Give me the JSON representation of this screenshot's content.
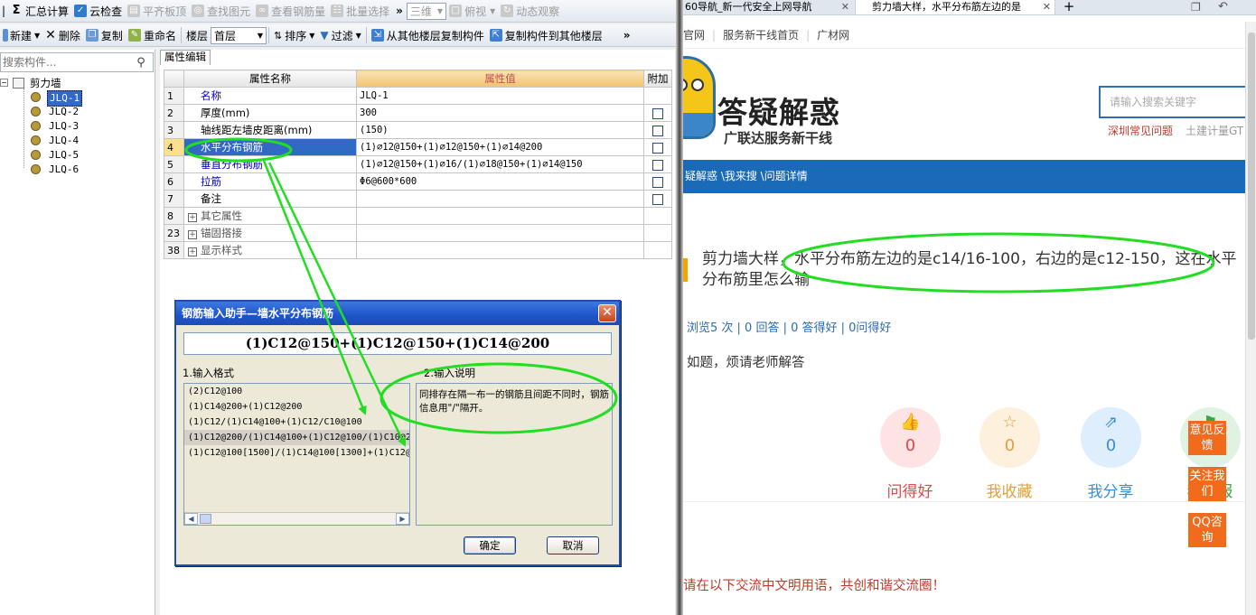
{
  "toolbar1": {
    "items": [
      {
        "icon": "sum-icon",
        "label": "汇总计算",
        "disabled": false
      },
      {
        "icon": "cloud-check-icon",
        "label": "云检查",
        "disabled": false
      },
      {
        "icon": "align-slab-icon",
        "label": "平齐板顶",
        "disabled": true
      },
      {
        "icon": "find-element-icon",
        "label": "查找图元",
        "disabled": true
      },
      {
        "icon": "view-rebar-icon",
        "label": "查看钢筋量",
        "disabled": true
      },
      {
        "icon": "batch-select-icon",
        "label": "批量选择",
        "disabled": true
      }
    ],
    "more_glyph": "»",
    "view_mode": "三维",
    "view_angle": "俯视",
    "dynamic_label": "动态观察"
  },
  "toolbar2": {
    "new_label": "新建",
    "delete_label": "删除",
    "copy_label": "复制",
    "rename_label": "重命名",
    "floor_label": "楼层",
    "floor_value": "首层",
    "sort_label": "排序",
    "filter_label": "过滤",
    "copy_from_label": "从其他楼层复制构件",
    "copy_to_label": "复制构件到其他楼层",
    "more_glyph": "»"
  },
  "left_panel": {
    "search_placeholder": "搜索构件...",
    "tree_root": "剪力墙",
    "tree_items": [
      "JLQ-1",
      "JLQ-2",
      "JLQ-3",
      "JLQ-4",
      "JLQ-5",
      "JLQ-6"
    ],
    "selected_index": 0
  },
  "property_editor": {
    "tab_label": "属性编辑",
    "headers": [
      "属性名称",
      "属性值",
      "附加"
    ],
    "rows": [
      {
        "num": "1",
        "name": "名称",
        "value": "JLQ-1",
        "blue": true,
        "checkbox": false,
        "group": false
      },
      {
        "num": "2",
        "name": "厚度(mm)",
        "value": "300",
        "blue": false,
        "checkbox": true,
        "group": false
      },
      {
        "num": "3",
        "name": "轴线距左墙皮距离(mm)",
        "value": "(150)",
        "blue": false,
        "checkbox": true,
        "group": false
      },
      {
        "num": "4",
        "name": "水平分布钢筋",
        "value": "(1)⌀12@150+(1)⌀12@150+(1)⌀14@200",
        "blue": true,
        "checkbox": true,
        "group": false,
        "selected": true
      },
      {
        "num": "5",
        "name": "垂直分布钢筋",
        "value": "(1)⌀12@150+(1)⌀16/(1)⌀18@150+(1)⌀14@150",
        "blue": true,
        "checkbox": true,
        "group": false
      },
      {
        "num": "6",
        "name": "拉筋",
        "value": "Φ6@600*600",
        "blue": true,
        "checkbox": true,
        "group": false
      },
      {
        "num": "7",
        "name": "备注",
        "value": "",
        "blue": false,
        "checkbox": true,
        "group": false
      },
      {
        "num": "8",
        "name": "其它属性",
        "value": "",
        "blue": false,
        "checkbox": false,
        "group": true
      },
      {
        "num": "23",
        "name": "锚固搭接",
        "value": "",
        "blue": false,
        "checkbox": false,
        "group": true
      },
      {
        "num": "38",
        "name": "显示样式",
        "value": "",
        "blue": false,
        "checkbox": false,
        "group": true
      }
    ]
  },
  "dialog": {
    "title": "钢筋输入助手—墙水平分布钢筋",
    "input_value": "(1)C12@150+(1)C12@150+(1)C14@200",
    "format_label": "1.输入格式",
    "desc_label": "2.输入说明",
    "formats": [
      "(2)C12@100",
      "(1)C14@200+(1)C12@200",
      "(1)C12/(1)C14@100+(1)C12/C10@100",
      "(1)C12@200/(1)C14@100+(1)C12@100/(1)C10@2",
      "(1)C12@100[1500]/(1)C14@100[1300]+(1)C12@"
    ],
    "selected_format": 3,
    "description": "同排存在隔一布一的钢筋且间距不同时，钢筋信息用\"/\"隔开。",
    "ok_label": "确定",
    "cancel_label": "取消"
  },
  "browser": {
    "tabs": [
      {
        "label": "60导航_新一代安全上网导航",
        "active": false
      },
      {
        "label": "剪力墙大样，水平分布筋左边的是",
        "active": true
      }
    ],
    "new_tab_glyph": "+",
    "favorites": [
      "官网",
      "服务新干线首页",
      "广材网"
    ],
    "logo_text": "答疑解惑",
    "slogan": "广联达服务新干线",
    "search_placeholder": "请输入搜索关键字",
    "hot_links": [
      "深圳常见问题",
      "土建计量GT"
    ],
    "breadcrumb": "疑解惑 \\我来搜 \\问题详情",
    "question_title": "剪力墙大样，水平分布筋左边的是c14/16-100，右边的是c12-150，这在水平分布筋里怎么输",
    "stats": "浏览5 次 | 0 回答 | 0 答得好 | 0问得好",
    "question_body": "如题，烦请老师解答",
    "actions": [
      {
        "icon": "thumbs-up-icon",
        "count": "0",
        "label": "问得好",
        "color": "#e0474c",
        "bg": "#fde3e3"
      },
      {
        "icon": "star-icon",
        "count": "0",
        "label": "我收藏",
        "color": "#e0a13b",
        "bg": "#fdf0dc"
      },
      {
        "icon": "share-icon",
        "count": "0",
        "label": "我分享",
        "color": "#3a8ed8",
        "bg": "#deeefc"
      },
      {
        "icon": "report-icon",
        "count": "",
        "label": "我举报",
        "color": "#3aa54a",
        "bg": "#e0f3e2"
      }
    ],
    "float_buttons": [
      "意见反馈",
      "关注我们",
      "QQ咨询"
    ],
    "footer_note": "请在以下交流中文明用语，共创和谐交流圈！"
  },
  "colors": {
    "annotation": "#22dd22",
    "navbar": "#1a6ab8",
    "float": "#f26a1b"
  }
}
